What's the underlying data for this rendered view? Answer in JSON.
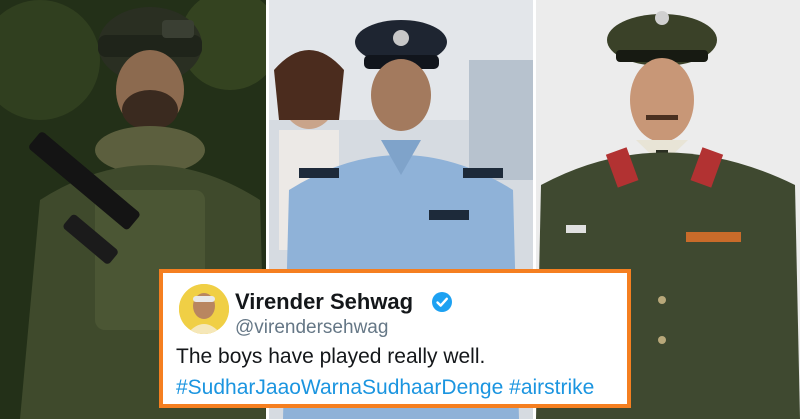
{
  "tweet": {
    "name": "Virender Sehwag",
    "handle": "@virendersehwag",
    "text": "The boys have played really well.",
    "hashtags": [
      "#SudharJaaoWarnaSudhaarDenge",
      "#airstrike"
    ]
  },
  "colors": {
    "frame": "#f57f20",
    "hashtag": "#1b95e0",
    "verified": "#1da1f2"
  },
  "icons": [
    "verified-badge-icon"
  ]
}
